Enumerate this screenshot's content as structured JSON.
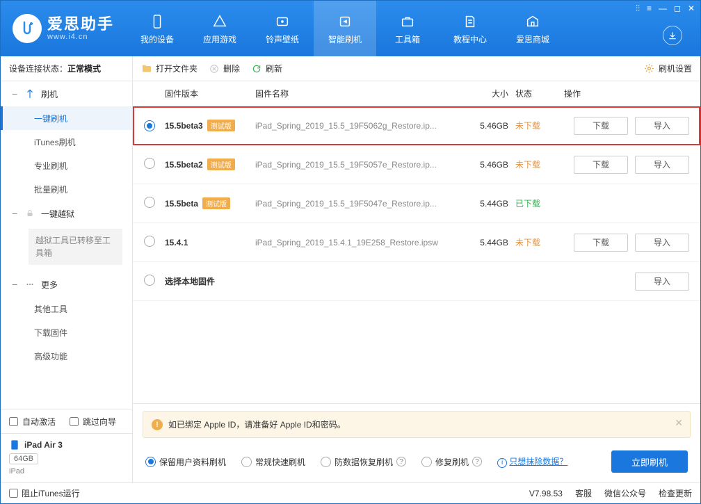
{
  "header": {
    "app_name": "爱思助手",
    "app_url": "www.i4.cn",
    "nav": [
      {
        "label": "我的设备"
      },
      {
        "label": "应用游戏"
      },
      {
        "label": "铃声壁纸"
      },
      {
        "label": "智能刷机"
      },
      {
        "label": "工具箱"
      },
      {
        "label": "教程中心"
      },
      {
        "label": "爱思商城"
      }
    ]
  },
  "sidebar": {
    "conn_label": "设备连接状态：",
    "conn_value": "正常模式",
    "group_flash": "刷机",
    "items_flash": [
      "一键刷机",
      "iTunes刷机",
      "专业刷机",
      "批量刷机"
    ],
    "group_jailbreak": "一键越狱",
    "jailbreak_note": "越狱工具已转移至工具箱",
    "group_more": "更多",
    "items_more": [
      "其他工具",
      "下载固件",
      "高级功能"
    ],
    "auto_activate": "自动激活",
    "skip_guide": "跳过向导",
    "device_name": "iPad Air 3",
    "device_capacity": "64GB",
    "device_type": "iPad"
  },
  "toolbar": {
    "open_folder": "打开文件夹",
    "delete": "删除",
    "refresh": "刷新",
    "settings": "刷机设置"
  },
  "columns": {
    "version": "固件版本",
    "name": "固件名称",
    "size": "大小",
    "status": "状态",
    "ops": "操作"
  },
  "badge_beta": "测试版",
  "btn_download": "下载",
  "btn_import": "导入",
  "rows": [
    {
      "selected": true,
      "highlight": true,
      "version": "15.5beta3",
      "beta": true,
      "name": "iPad_Spring_2019_15.5_19F5062g_Restore.ip...",
      "size": "5.46GB",
      "status": "未下载",
      "status_cls": "not",
      "download": true,
      "import": true
    },
    {
      "selected": false,
      "version": "15.5beta2",
      "beta": true,
      "name": "iPad_Spring_2019_15.5_19F5057e_Restore.ip...",
      "size": "5.46GB",
      "status": "未下载",
      "status_cls": "not",
      "download": true,
      "import": true
    },
    {
      "selected": false,
      "version": "15.5beta",
      "beta": true,
      "name": "iPad_Spring_2019_15.5_19F5047e_Restore.ip...",
      "size": "5.44GB",
      "status": "已下载",
      "status_cls": "done",
      "download": false,
      "import": false
    },
    {
      "selected": false,
      "version": "15.4.1",
      "beta": false,
      "name": "iPad_Spring_2019_15.4.1_19E258_Restore.ipsw",
      "size": "5.44GB",
      "status": "未下载",
      "status_cls": "not",
      "download": true,
      "import": true
    },
    {
      "selected": false,
      "version": "选择本地固件",
      "beta": false,
      "local": true,
      "name": "",
      "size": "",
      "status": "",
      "download": false,
      "import": true
    }
  ],
  "alert": "如已绑定 Apple ID，请准备好 Apple ID和密码。",
  "flash_opts": [
    "保留用户资料刷机",
    "常规快速刷机",
    "防数据恢复刷机",
    "修复刷机"
  ],
  "erase_link": "只想抹除数据？",
  "flash_button": "立即刷机",
  "statusbar": {
    "block_itunes": "阻止iTunes运行",
    "version": "V7.98.53",
    "support": "客服",
    "wechat": "微信公众号",
    "check_update": "检查更新"
  }
}
